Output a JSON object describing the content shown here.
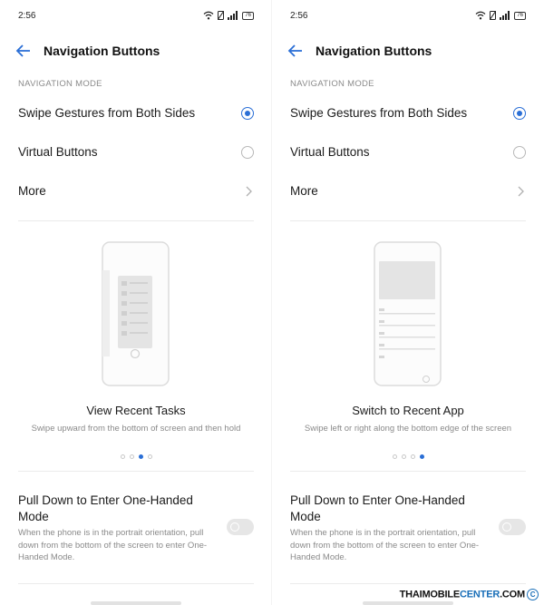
{
  "screens": [
    {
      "status": {
        "time": "2:56",
        "battery": "76"
      },
      "header": {
        "title": "Navigation Buttons"
      },
      "section_label": "NAVIGATION MODE",
      "options": [
        {
          "label": "Swipe Gestures from Both Sides",
          "selected": true
        },
        {
          "label": "Virtual Buttons",
          "selected": false
        }
      ],
      "more_label": "More",
      "carousel": {
        "caption": "View Recent Tasks",
        "description": "Swipe upward from the bottom of screen and then hold",
        "page_count": 4,
        "active_page": 3
      },
      "one_handed": {
        "title": "Pull Down to Enter One-Handed Mode",
        "description": "When the phone is in the portrait orientation, pull down from the bottom of the screen to enter One-Handed Mode.",
        "enabled": false
      }
    },
    {
      "status": {
        "time": "2:56",
        "battery": "76"
      },
      "header": {
        "title": "Navigation Buttons"
      },
      "section_label": "NAVIGATION MODE",
      "options": [
        {
          "label": "Swipe Gestures from Both Sides",
          "selected": true
        },
        {
          "label": "Virtual Buttons",
          "selected": false
        }
      ],
      "more_label": "More",
      "carousel": {
        "caption": "Switch to Recent App",
        "description": "Swipe left or right along the bottom edge of the screen",
        "page_count": 4,
        "active_page": 4
      },
      "one_handed": {
        "title": "Pull Down to Enter One-Handed Mode",
        "description": "When the phone is in the portrait orientation, pull down from the bottom of the screen to enter One-Handed Mode.",
        "enabled": false
      }
    }
  ],
  "watermark": {
    "brand_a": "THAIMOBILE",
    "brand_b": "CENTER",
    "suffix": ".COM",
    "symbol": "C"
  },
  "colors": {
    "accent": "#2b6fd6",
    "watermark_accent": "#1a6fb8"
  }
}
